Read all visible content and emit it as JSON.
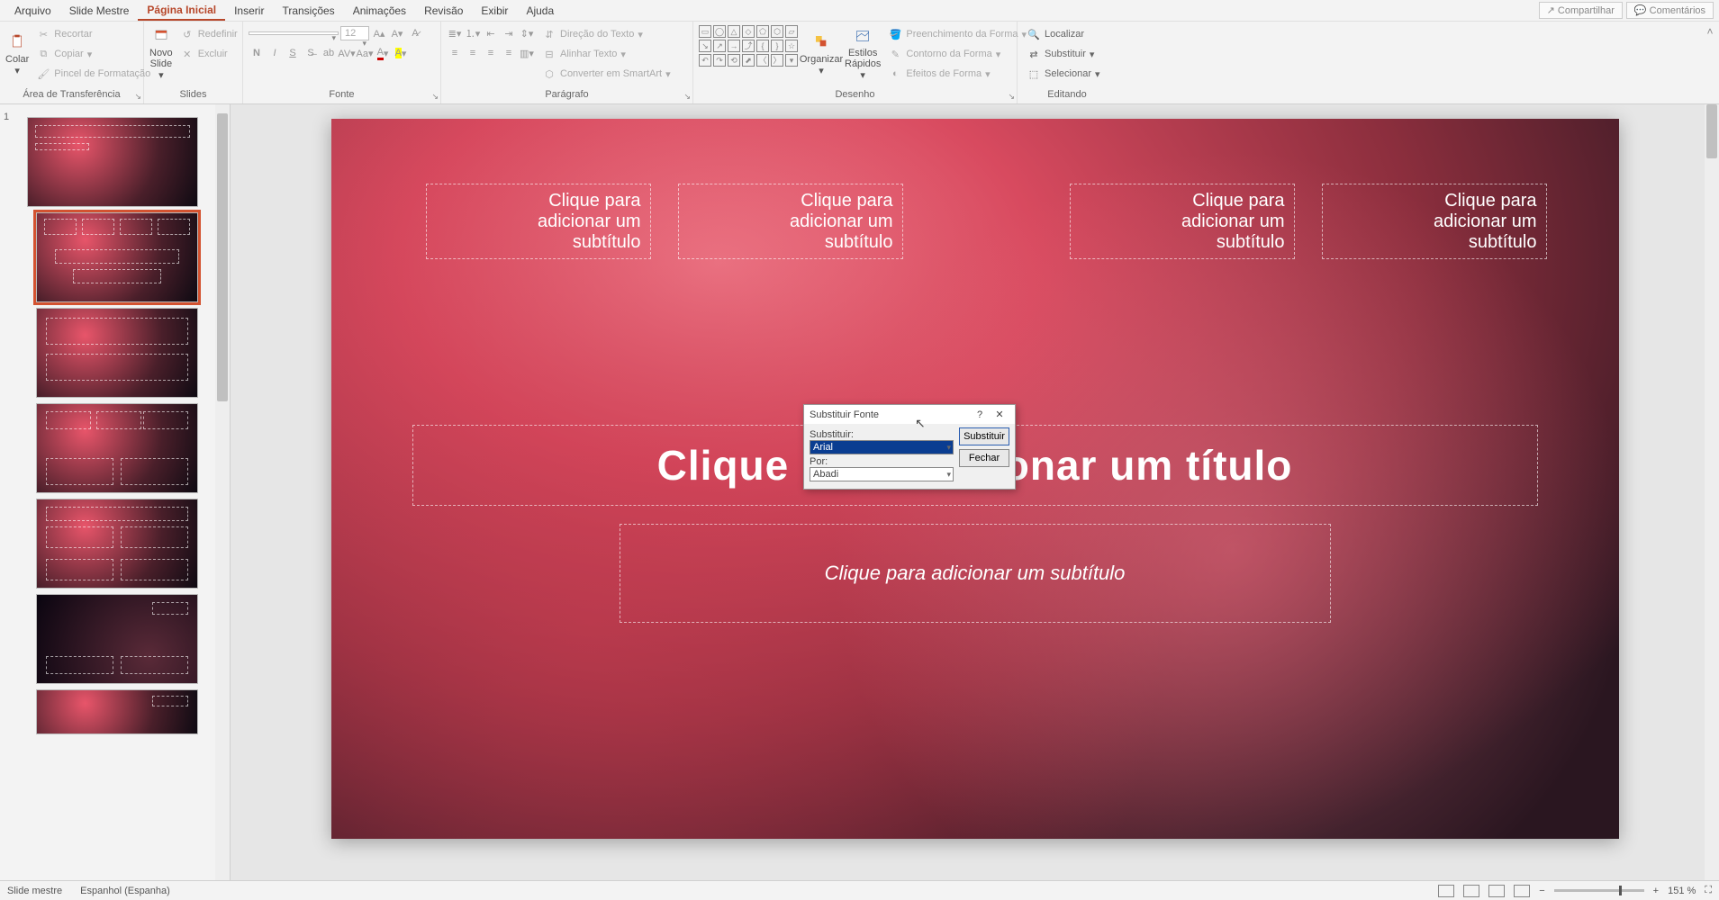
{
  "menu": {
    "tabs": [
      "Arquivo",
      "Slide Mestre",
      "Página Inicial",
      "Inserir",
      "Transições",
      "Animações",
      "Revisão",
      "Exibir",
      "Ajuda"
    ],
    "active_index": 2,
    "share": "Compartilhar",
    "comments": "Comentários"
  },
  "ribbon": {
    "clipboard": {
      "title": "Área de Transferência",
      "paste": "Colar",
      "cut": "Recortar",
      "copy": "Copiar",
      "format_painter": "Pincel de Formatação",
      "reset": "Redefinir",
      "delete": "Excluir"
    },
    "slides": {
      "title": "Slides",
      "new_slide": "Novo\nSlide"
    },
    "font": {
      "title": "Fonte",
      "name": "",
      "size": "12"
    },
    "paragraph": {
      "title": "Parágrafo",
      "text_direction": "Direção do Texto",
      "align_text": "Alinhar Texto",
      "convert_smartart": "Converter em SmartArt"
    },
    "drawing": {
      "title": "Desenho",
      "arrange": "Organizar",
      "quick_styles": "Estilos\nRápidos",
      "shape_fill": "Preenchimento da Forma",
      "shape_outline": "Contorno da Forma",
      "shape_effects": "Efeitos de Forma"
    },
    "editing": {
      "title": "Editando",
      "find": "Localizar",
      "replace": "Substituir",
      "select": "Selecionar"
    }
  },
  "slide_content": {
    "sub_placeholder": "Clique para\nadicionar um\nsubtítulo",
    "title_placeholder": "Clique para adicionar um título",
    "subtitle_placeholder": "Clique para adicionar um subtítulo"
  },
  "dialog": {
    "title": "Substituir Fonte",
    "replace_label": "Substituir:",
    "replace_value": "Arial",
    "with_label": "Por:",
    "with_value": "Abadi",
    "btn_replace": "Substituir",
    "btn_close": "Fechar"
  },
  "status": {
    "left1": "Slide mestre",
    "left2": "Espanhol (Espanha)",
    "zoom": "151 %"
  },
  "slide_number": "1"
}
